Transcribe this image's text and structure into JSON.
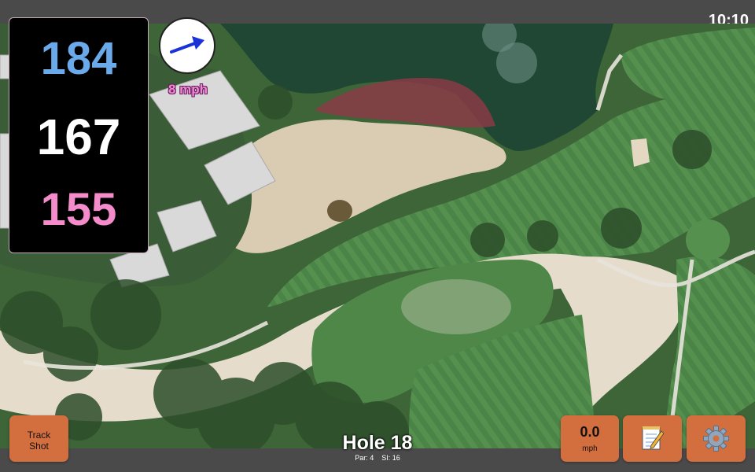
{
  "status_bar": {
    "time": "10:10"
  },
  "distances": {
    "back": "184",
    "middle": "167",
    "front": "155"
  },
  "wind": {
    "speed_label": "8 mph",
    "direction": "east-northeast",
    "arrow_icon": "wind-arrow-icon"
  },
  "hole": {
    "title": "Hole 18",
    "par_label": "Par: 4",
    "si_label": "SI: 16"
  },
  "buttons": {
    "track_shot_line1": "Track",
    "track_shot_line2": "Shot",
    "speed_value": "0.0",
    "speed_unit": "mph",
    "notes_icon": "notepad-icon",
    "settings_icon": "gear-icon"
  },
  "colors": {
    "back_distance": "#6aa9ea",
    "middle_distance": "#ffffff",
    "front_distance": "#f48ccb",
    "button_accent": "#d36f3f",
    "wind_arrow": "#1a33d8",
    "bar": "#4a4a4a"
  }
}
